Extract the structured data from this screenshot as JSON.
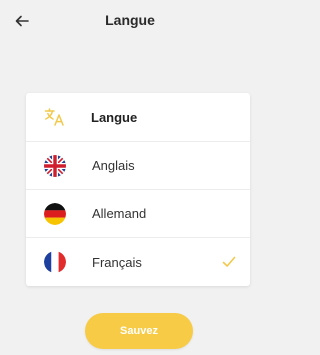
{
  "header": {
    "title": "Langue",
    "back_icon": "arrow-left-icon"
  },
  "language_list": {
    "heading": {
      "label": "Langue",
      "icon": "translate-icon",
      "icon_color": "#f2c94c"
    },
    "items": [
      {
        "label": "Anglais",
        "flag": "uk-flag-icon",
        "selected": false
      },
      {
        "label": "Allemand",
        "flag": "germany-flag-icon",
        "selected": false
      },
      {
        "label": "Français",
        "flag": "france-flag-icon",
        "selected": true
      }
    ],
    "check_color": "#f2c94c"
  },
  "save_button": {
    "label": "Sauvez",
    "color": "#f7cb45"
  }
}
